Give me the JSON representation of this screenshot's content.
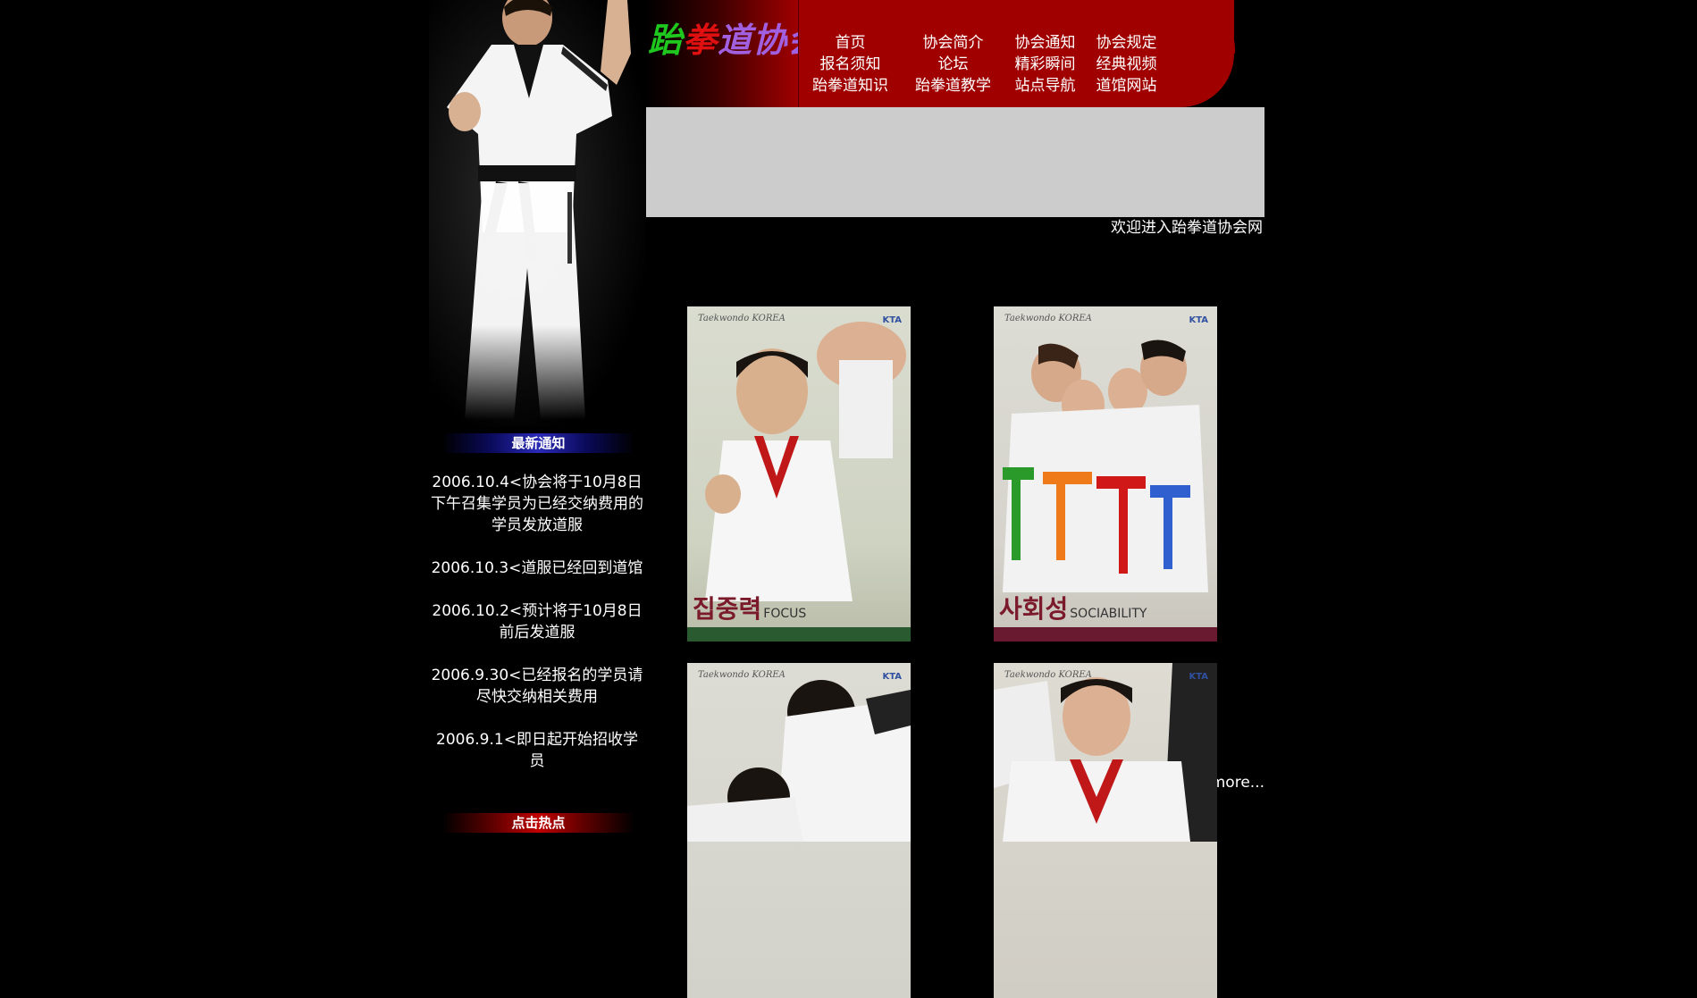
{
  "header": {
    "logo_parts": [
      "跆",
      "拳",
      "道协会"
    ],
    "nav": [
      [
        "首页",
        "协会简介",
        "协会通知",
        "协会规定"
      ],
      [
        "报名须知",
        "论坛",
        "精彩瞬间",
        "经典视频"
      ],
      [
        "跆拳道知识",
        "跆拳道教学",
        "站点导航",
        "道馆网站"
      ]
    ]
  },
  "marquee": {
    "text": "欢迎进入跆拳道协会网"
  },
  "sidebar": {
    "latest_title": "最新通知",
    "notices": [
      "2006.10.4<协会将于10月8日下午召集学员为已经交纳费用的学员发放道服",
      "2006.10.3<道服已经回到道馆",
      "2006.10.2<预计将于10月8日前后发道服",
      "2006.9.30<已经报名的学员请尽快交纳相关费用",
      "2006.9.1<即日起开始招收学员"
    ],
    "more": "more...",
    "hot_title": "点击热点"
  },
  "photos": [
    {
      "brand": "Taekwondo KOREA",
      "badge": "KTA",
      "caption_ko": "집중력",
      "caption_en": "FOCUS",
      "strip_color": "#2a5a30"
    },
    {
      "brand": "Taekwondo KOREA",
      "badge": "KTA",
      "caption_ko": "사회성",
      "caption_en": "SOCIABILITY",
      "strip_color": "#6a1a30"
    },
    {
      "brand": "Taekwondo KOREA",
      "badge": "KTA",
      "caption_ko": "",
      "caption_en": ""
    },
    {
      "brand": "Taekwondo KOREA",
      "badge": "KTA",
      "caption_ko": "",
      "caption_en": ""
    }
  ],
  "colors": {
    "background": "#000000",
    "nav_red": "#a00000",
    "banner_gray": "#cccccc",
    "bar_blue": "#2a2ab8",
    "bar_red": "#c00000"
  }
}
